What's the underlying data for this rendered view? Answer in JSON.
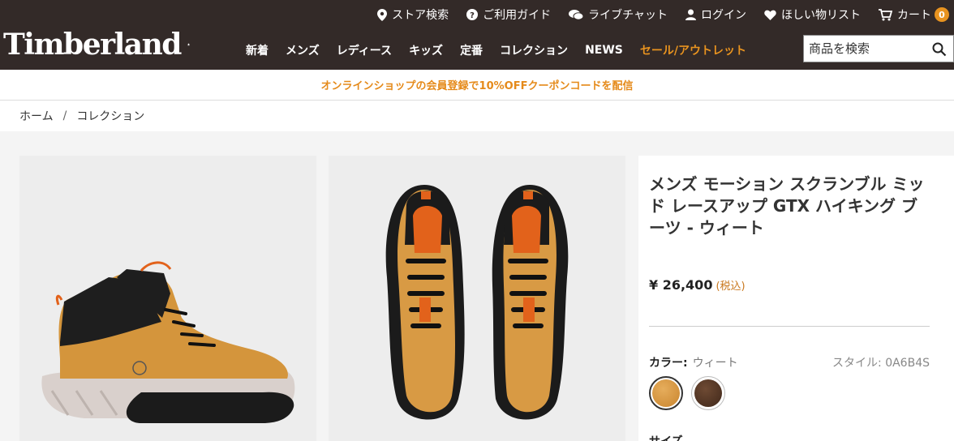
{
  "header": {
    "logo_text": "Timberland",
    "utility": {
      "store_search": "ストア検索",
      "guide": "ご利用ガイド",
      "live_chat": "ライブチャット",
      "login": "ログイン",
      "wishlist": "ほしい物リスト",
      "cart": "カート",
      "cart_count": "0"
    },
    "nav": {
      "new": "新着",
      "mens": "メンズ",
      "ladies": "レディース",
      "kids": "キッズ",
      "classic": "定番",
      "collection": "コレクション",
      "news": "NEWS",
      "sale": "セール/アウトレット"
    },
    "search_placeholder": "商品を検索"
  },
  "promo": {
    "text": "オンラインショップの会員登録で10%OFFクーポンコードを配信"
  },
  "breadcrumb": {
    "home": "ホーム",
    "separator": "/",
    "current": "コレクション"
  },
  "product": {
    "title": "メンズ モーション スクランブル ミッド レースアップ GTX ハイキング ブーツ - ウィート",
    "price": "¥ 26,400",
    "tax_note": "(税込)",
    "color_label": "カラー:",
    "color_value": "ウィート",
    "style": "スタイル: 0A6B4S",
    "size_label": "サイズ"
  },
  "colors": {
    "header_bg": "#332a28",
    "accent": "#e8931f",
    "wheat": "#d99a45",
    "brown": "#5a3a28"
  }
}
